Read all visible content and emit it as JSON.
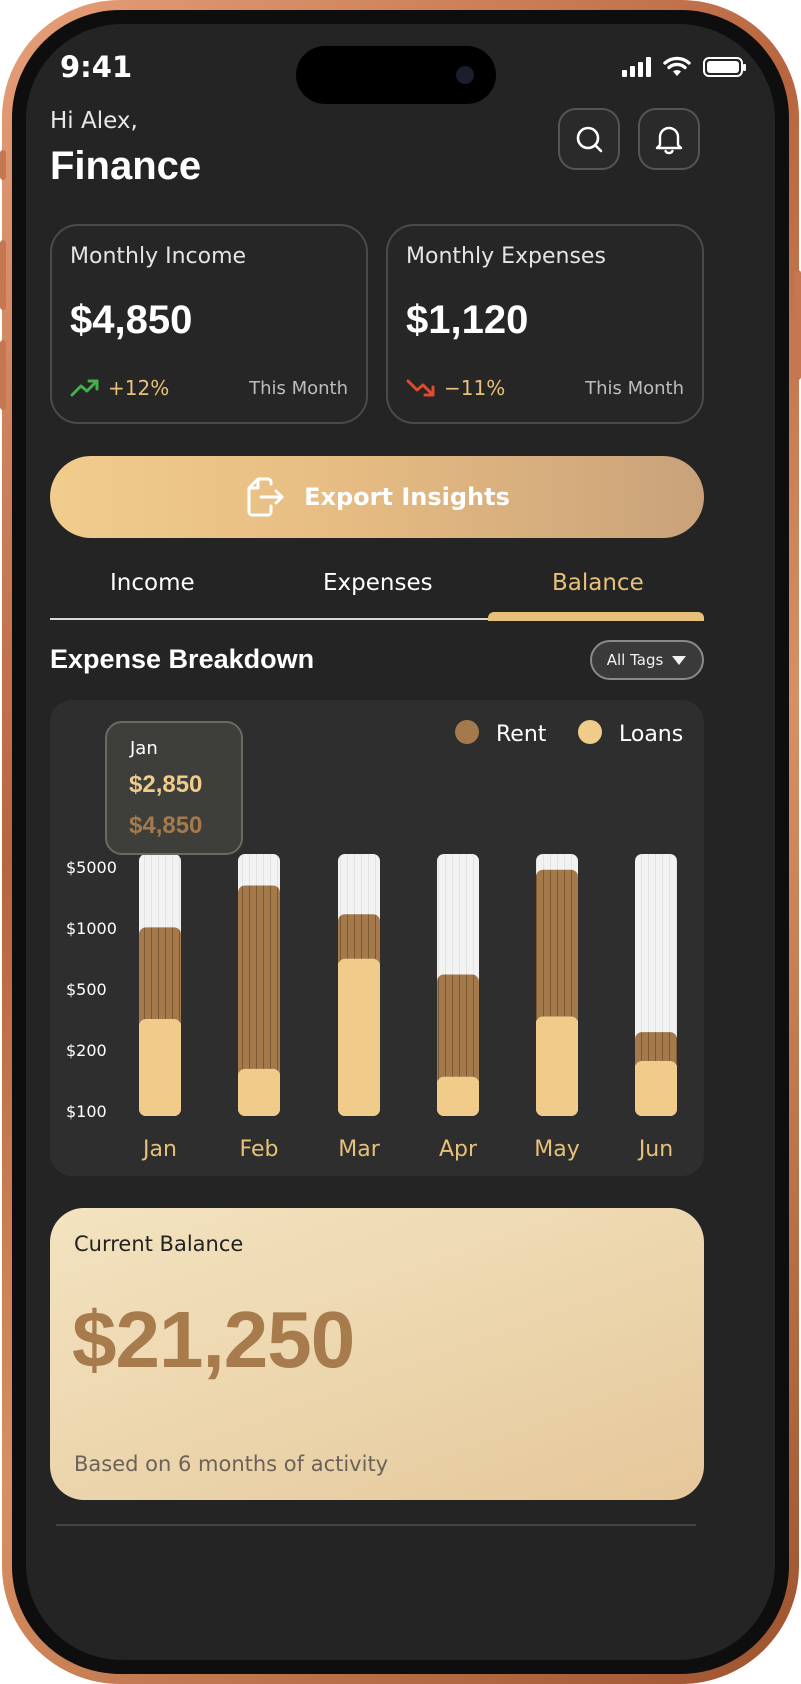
{
  "status": {
    "time": "9:41"
  },
  "header": {
    "greeting": "Hi Alex,",
    "title": "Finance",
    "search_icon": "search-icon",
    "bell_icon": "bell-icon"
  },
  "income_card": {
    "label": "Monthly Income",
    "value": "$4,850",
    "change": "+12%",
    "period": "This Month",
    "trend": "up"
  },
  "expense_card": {
    "label": "Monthly Expenses",
    "value": "$1,120",
    "change": "−11%",
    "period": "This Month",
    "trend": "down"
  },
  "export": {
    "label": "Export Insights",
    "icon": "export-file-icon"
  },
  "tabs": [
    {
      "label": "Income",
      "active": false
    },
    {
      "label": "Expenses",
      "active": false
    },
    {
      "label": "Balance",
      "active": true
    }
  ],
  "breakdown": {
    "title": "Expense Breakdown",
    "filter_label": "All Tags"
  },
  "colors": {
    "rent": "#a47a4c",
    "loans": "#f0cb8a",
    "accent": "#e7c17a",
    "up": "#43b04c",
    "down": "#e04a2e"
  },
  "chart_data": {
    "type": "bar",
    "stacked": true,
    "categories": [
      "Jan",
      "Feb",
      "Mar",
      "Apr",
      "May",
      "Jun"
    ],
    "y_tick_labels": [
      "$5000",
      "$1000",
      "$500",
      "$200",
      "$100"
    ],
    "series": [
      {
        "name": "Rent",
        "values": [
          0.35,
          0.7,
          0.17,
          0.39,
          0.56,
          0.11
        ]
      },
      {
        "name": "Loans",
        "values": [
          0.37,
          0.18,
          0.6,
          0.15,
          0.38,
          0.21
        ]
      }
    ],
    "legend_position": "top-right",
    "tooltip": {
      "category": "Jan",
      "loans_value": "$2,850",
      "rent_value": "$4,850"
    }
  },
  "balance": {
    "label": "Current Balance",
    "value": "$21,250",
    "note": "Based on 6 months of activity"
  }
}
